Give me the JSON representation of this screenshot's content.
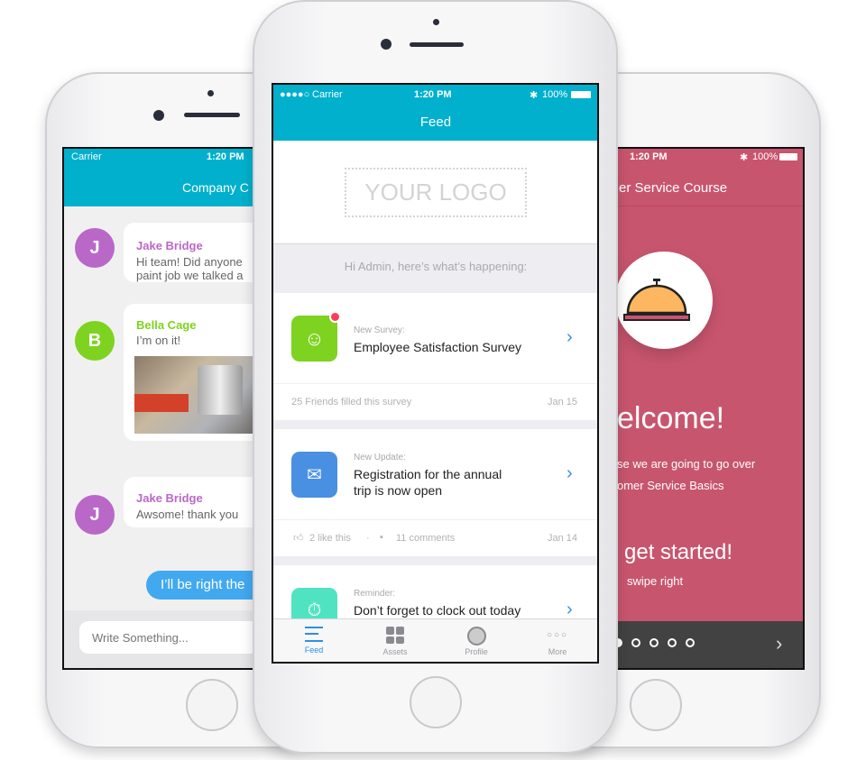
{
  "colors": {
    "teal": "#00b0cc",
    "course_bg": "#c8556e",
    "survey_green": "#7ed321",
    "update_blue": "#4a90e2",
    "reminder_teal": "#50e3c2",
    "badge_red": "#ff3b5c",
    "tab_active": "#2b8fe8",
    "chat_purple": "#b968c7",
    "chat_green": "#7ed321",
    "sent_bubble": "#42a9f0"
  },
  "left_phone": {
    "status": {
      "carrier": "Carrier",
      "time": "1:20 PM"
    },
    "header_title": "Company C",
    "messages": [
      {
        "avatar": "J",
        "name": "Jake Bridge",
        "text_line1": "Hi team! Did anyone",
        "text_line2": "paint job we talked a"
      },
      {
        "avatar": "B",
        "name": "Bella Cage",
        "text_line1": "I’m on it!"
      },
      {
        "avatar": "J",
        "name": "Jake Bridge",
        "text_line1": "Awsome! thank you"
      }
    ],
    "sent_message": "I’ll be right the",
    "input_placeholder": "Write Something..."
  },
  "center_phone": {
    "status": {
      "carrier": "Carrier",
      "time": "1:20 PM",
      "battery": "100%"
    },
    "header_title": "Feed",
    "logo_placeholder": "YOUR LOGO",
    "greeting": "Hi Admin, here’s what’s happening:",
    "cards": [
      {
        "icon": "survey-people-icon",
        "label": "New Survey:",
        "title": "Employee Satisfaction Survey",
        "footer": "25 Friends filled this survey",
        "date": "Jan 15",
        "unread": true
      },
      {
        "icon": "envelope-icon",
        "label": "New Update:",
        "title_line1": "Registration for the annual",
        "title_line2": "trip is now open",
        "likes": "2 like this",
        "comments": "11 comments",
        "date": "Jan 14"
      },
      {
        "icon": "stopwatch-icon",
        "label": "Reminder:",
        "title": "Don’t forget to clock out today"
      }
    ],
    "tabs": [
      {
        "label": "Feed",
        "icon": "feed-lines-icon",
        "active": true
      },
      {
        "label": "Assets",
        "icon": "grid-icon"
      },
      {
        "label": "Profile",
        "icon": "profile-icon"
      },
      {
        "label": "More",
        "icon": "more-dots-icon"
      }
    ]
  },
  "right_phone": {
    "status": {
      "time": "1:20 PM",
      "battery": "100%"
    },
    "header_title": "er Service Course",
    "welcome": "elcome!",
    "desc_line1": "se we are going to go over",
    "desc_line2": "omer Service Basics",
    "cta": "get started!",
    "hint": "swipe right",
    "pager": {
      "pages": 5,
      "current": 1
    }
  }
}
